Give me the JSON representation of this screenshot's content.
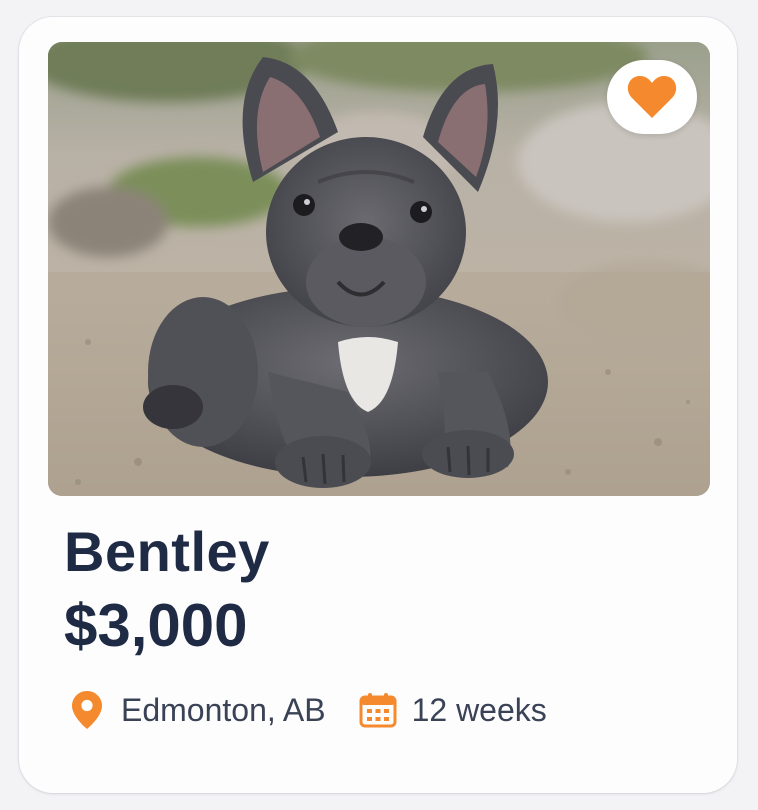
{
  "listing": {
    "name": "Bentley",
    "price": "$3,000",
    "location": "Edmonton, AB",
    "age": "12 weeks",
    "favorited": true
  },
  "icons": {
    "favorite": "heart-icon",
    "location": "map-pin-icon",
    "age": "calendar-icon"
  },
  "colors": {
    "accent": "#f5892d",
    "title": "#1f2a44",
    "meta_text": "#3a4256",
    "card_bg": "#fdfdfe"
  }
}
